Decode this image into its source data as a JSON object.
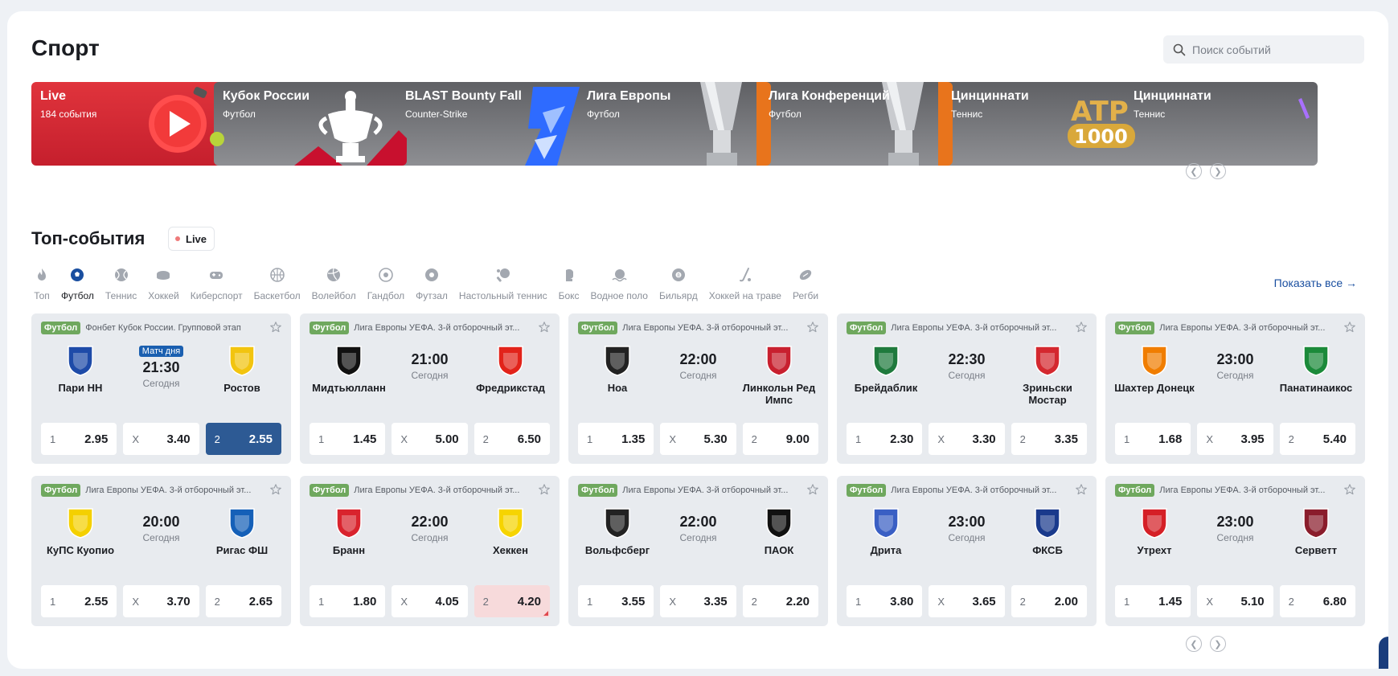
{
  "header": {
    "title": "Спорт",
    "search_placeholder": "Поиск событий"
  },
  "banners": [
    {
      "title": "Live",
      "subtitle": "184 события",
      "style": "red",
      "art": "play-icon"
    },
    {
      "title": "Кубок России",
      "subtitle": "Футбол",
      "style": "gray",
      "art": "trophy-icon"
    },
    {
      "title": "BLAST Bounty Fall",
      "subtitle": "Counter-Strike",
      "style": "gray",
      "art": "blast-logo"
    },
    {
      "title": "Лига Европы",
      "subtitle": "Футбол",
      "style": "gray",
      "art": "cup-icon"
    },
    {
      "title": "Лига Конференций",
      "subtitle": "Футбол",
      "style": "gray",
      "art": "cup-icon"
    },
    {
      "title": "Цинциннати",
      "subtitle": "Теннис",
      "style": "gray",
      "art": "atp-1000-logo",
      "art_text": "1000"
    },
    {
      "title": "Цинциннати",
      "subtitle": "Теннис",
      "style": "gray",
      "art": "wta-logo"
    }
  ],
  "top_events": {
    "title": "Топ-события",
    "live_label": "Live",
    "show_all": "Показать все →",
    "sports": [
      {
        "label": "Топ",
        "icon": "flame-icon",
        "active": false
      },
      {
        "label": "Футбол",
        "icon": "soccer-ball-icon",
        "active": true
      },
      {
        "label": "Теннис",
        "icon": "tennis-ball-icon",
        "active": false
      },
      {
        "label": "Хоккей",
        "icon": "hockey-puck-icon",
        "active": false
      },
      {
        "label": "Киберспорт",
        "icon": "gamepad-icon",
        "active": false
      },
      {
        "label": "Баскетбол",
        "icon": "basketball-icon",
        "active": false
      },
      {
        "label": "Волейбол",
        "icon": "volleyball-icon",
        "active": false
      },
      {
        "label": "Гандбол",
        "icon": "handball-icon",
        "active": false
      },
      {
        "label": "Футзал",
        "icon": "futsal-ball-icon",
        "active": false
      },
      {
        "label": "Настольный теннис",
        "icon": "table-tennis-icon",
        "active": false
      },
      {
        "label": "Бокс",
        "icon": "boxing-glove-icon",
        "active": false
      },
      {
        "label": "Водное поло",
        "icon": "water-polo-icon",
        "active": false
      },
      {
        "label": "Бильярд",
        "icon": "billiard-ball-icon",
        "active": false
      },
      {
        "label": "Хоккей на траве",
        "icon": "field-hockey-icon",
        "active": false
      },
      {
        "label": "Регби",
        "icon": "rugby-ball-icon",
        "active": false
      }
    ],
    "events": [
      {
        "sport": "Футбол",
        "league": "Фонбет Кубок России. Групповой этап",
        "team1": "Пари НН",
        "team2": "Ростов",
        "badge": "Матч дня",
        "time": "21:30",
        "day": "Сегодня",
        "logo1": "#1e4ba8",
        "logo2": "#f2c40f",
        "odds": [
          {
            "label": "1",
            "value": "2.95",
            "state": ""
          },
          {
            "label": "X",
            "value": "3.40",
            "state": ""
          },
          {
            "label": "2",
            "value": "2.55",
            "state": "selected"
          }
        ]
      },
      {
        "sport": "Футбол",
        "league": "Лига Европы УЕФА. 3-й отборочный эт...",
        "team1": "Мидтьюлланн",
        "team2": "Фредрикстад",
        "badge": "",
        "time": "21:00",
        "day": "Сегодня",
        "logo1": "#111111",
        "logo2": "#e2231a",
        "odds": [
          {
            "label": "1",
            "value": "1.45",
            "state": ""
          },
          {
            "label": "X",
            "value": "5.00",
            "state": ""
          },
          {
            "label": "2",
            "value": "6.50",
            "state": ""
          }
        ]
      },
      {
        "sport": "Футбол",
        "league": "Лига Европы УЕФА. 3-й отборочный эт...",
        "team1": "Ноа",
        "team2": "Линкольн Ред Импс",
        "badge": "",
        "time": "22:00",
        "day": "Сегодня",
        "logo1": "#222222",
        "logo2": "#c8202f",
        "odds": [
          {
            "label": "1",
            "value": "1.35",
            "state": ""
          },
          {
            "label": "X",
            "value": "5.30",
            "state": ""
          },
          {
            "label": "2",
            "value": "9.00",
            "state": ""
          }
        ]
      },
      {
        "sport": "Футбол",
        "league": "Лига Европы УЕФА. 3-й отборочный эт...",
        "team1": "Брейдаблик",
        "team2": "Зриньски Мостар",
        "badge": "",
        "time": "22:30",
        "day": "Сегодня",
        "logo1": "#1f7a3d",
        "logo2": "#d4282f",
        "odds": [
          {
            "label": "1",
            "value": "2.30",
            "state": ""
          },
          {
            "label": "X",
            "value": "3.30",
            "state": ""
          },
          {
            "label": "2",
            "value": "3.35",
            "state": ""
          }
        ]
      },
      {
        "sport": "Футбол",
        "league": "Лига Европы УЕФА. 3-й отборочный эт...",
        "team1": "Шахтер Донецк",
        "team2": "Панатинаикос",
        "badge": "",
        "time": "23:00",
        "day": "Сегодня",
        "logo1": "#f07d00",
        "logo2": "#1b8a3a",
        "odds": [
          {
            "label": "1",
            "value": "1.68",
            "state": ""
          },
          {
            "label": "X",
            "value": "3.95",
            "state": ""
          },
          {
            "label": "2",
            "value": "5.40",
            "state": ""
          }
        ]
      },
      {
        "sport": "Футбол",
        "league": "Лига Европы УЕФА. 3-й отборочный эт...",
        "team1": "КуПС Куопио",
        "team2": "Ригас ФШ",
        "badge": "",
        "time": "20:00",
        "day": "Сегодня",
        "logo1": "#f4d000",
        "logo2": "#1560b8",
        "odds": [
          {
            "label": "1",
            "value": "2.55",
            "state": ""
          },
          {
            "label": "X",
            "value": "3.70",
            "state": ""
          },
          {
            "label": "2",
            "value": "2.65",
            "state": ""
          }
        ]
      },
      {
        "sport": "Футбол",
        "league": "Лига Европы УЕФА. 3-й отборочный эт...",
        "team1": "Бранн",
        "team2": "Хеккен",
        "badge": "",
        "time": "22:00",
        "day": "Сегодня",
        "logo1": "#d9232d",
        "logo2": "#f6d400",
        "odds": [
          {
            "label": "1",
            "value": "1.80",
            "state": ""
          },
          {
            "label": "X",
            "value": "4.05",
            "state": ""
          },
          {
            "label": "2",
            "value": "4.20",
            "state": "down"
          }
        ]
      },
      {
        "sport": "Футбол",
        "league": "Лига Европы УЕФА. 3-й отборочный эт...",
        "team1": "Вольфсберг",
        "team2": "ПАОК",
        "badge": "",
        "time": "22:00",
        "day": "Сегодня",
        "logo1": "#222222",
        "logo2": "#111111",
        "odds": [
          {
            "label": "1",
            "value": "3.55",
            "state": ""
          },
          {
            "label": "X",
            "value": "3.35",
            "state": ""
          },
          {
            "label": "2",
            "value": "2.20",
            "state": ""
          }
        ]
      },
      {
        "sport": "Футбол",
        "league": "Лига Европы УЕФА. 3-й отборочный эт...",
        "team1": "Дрита",
        "team2": "ФКСБ",
        "badge": "",
        "time": "23:00",
        "day": "Сегодня",
        "logo1": "#3a5fc4",
        "logo2": "#1a3a8c",
        "odds": [
          {
            "label": "1",
            "value": "3.80",
            "state": ""
          },
          {
            "label": "X",
            "value": "3.65",
            "state": ""
          },
          {
            "label": "2",
            "value": "2.00",
            "state": ""
          }
        ]
      },
      {
        "sport": "Футбол",
        "league": "Лига Европы УЕФА. 3-й отборочный эт...",
        "team1": "Утрехт",
        "team2": "Серветт",
        "badge": "",
        "time": "23:00",
        "day": "Сегодня",
        "logo1": "#d51f26",
        "logo2": "#8a1d2c",
        "odds": [
          {
            "label": "1",
            "value": "1.45",
            "state": ""
          },
          {
            "label": "X",
            "value": "5.10",
            "state": ""
          },
          {
            "label": "2",
            "value": "6.80",
            "state": ""
          }
        ]
      }
    ]
  },
  "colors": {
    "accent": "#1a4fa0",
    "sport_tag": "#6fa85e",
    "selected_odd": "#2d5a94",
    "card_bg": "#e8ebef"
  }
}
